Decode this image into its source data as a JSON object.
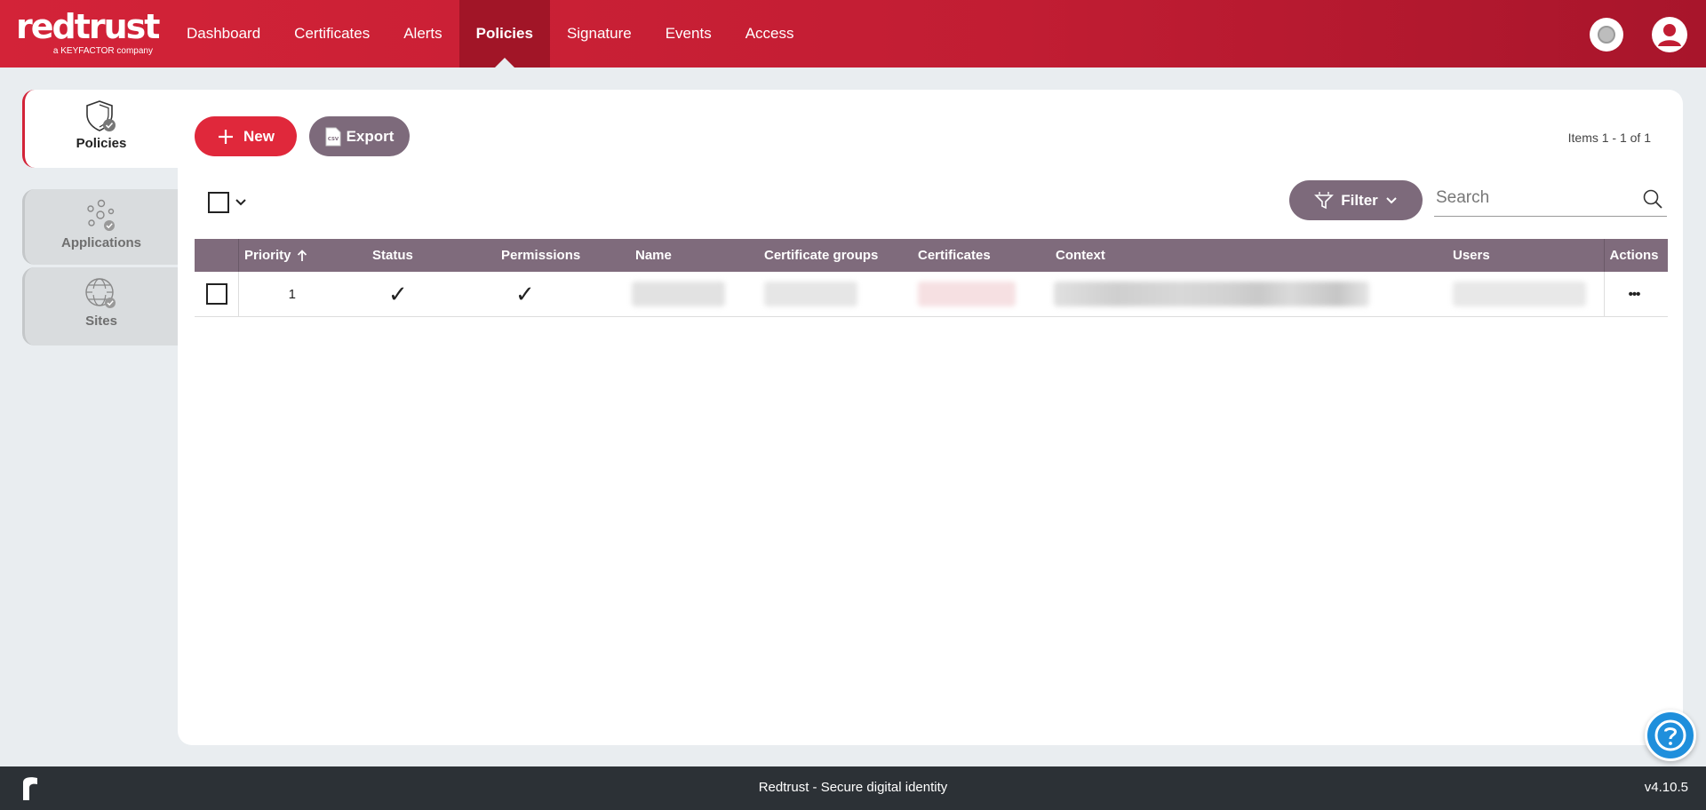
{
  "brand": {
    "name": "redtrust",
    "tagline": "a KEYFACTOR company"
  },
  "nav": {
    "items": [
      {
        "label": "Dashboard"
      },
      {
        "label": "Certificates"
      },
      {
        "label": "Alerts"
      },
      {
        "label": "Policies",
        "active": true
      },
      {
        "label": "Signature"
      },
      {
        "label": "Events"
      },
      {
        "label": "Access"
      }
    ]
  },
  "sidebar": {
    "tabs": [
      {
        "label": "Policies",
        "icon": "shield-check-icon",
        "active": true
      },
      {
        "label": "Applications",
        "icon": "applications-icon"
      },
      {
        "label": "Sites",
        "icon": "globe-check-icon"
      }
    ]
  },
  "toolbar": {
    "new_label": "New",
    "export_label": "Export",
    "export_icon_text": "CSV",
    "items_count": "Items 1 - 1 of 1",
    "filter_label": "Filter",
    "search_placeholder": "Search"
  },
  "table": {
    "columns": [
      "Priority",
      "Status",
      "Permissions",
      "Name",
      "Certificate groups",
      "Certificates",
      "Context",
      "Users",
      "Actions"
    ],
    "sort": {
      "column": "Priority",
      "direction": "ascending"
    },
    "rows": [
      {
        "priority": "1",
        "status": "✓",
        "permissions": "✓",
        "actions": "•••"
      }
    ]
  },
  "footer": {
    "text": "Redtrust - Secure digital identity",
    "version": "v4.10.5"
  },
  "colors": {
    "brand_red": "#d32338",
    "accent_purple": "#7d6a7b",
    "help_blue": "#1f8fdc",
    "footer_dark": "#2c3136"
  }
}
